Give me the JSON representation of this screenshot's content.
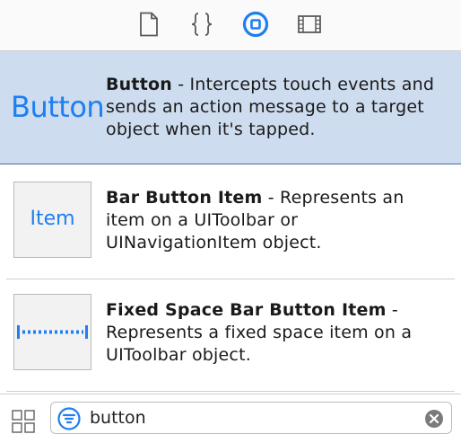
{
  "tabs": [
    {
      "icon": "file-icon",
      "selected": false
    },
    {
      "icon": "code-braces-icon",
      "selected": false
    },
    {
      "icon": "object-library-icon",
      "selected": true
    },
    {
      "icon": "media-library-icon",
      "selected": false
    }
  ],
  "items": [
    {
      "preview_text": "Button",
      "title": "Button",
      "description": " - Intercepts touch events and sends an action message to a target object when it's tapped.",
      "selected": true
    },
    {
      "preview_text": "Item",
      "title": "Bar Button Item",
      "description": " - Represents an item on a UIToolbar or UINavigationItem object.",
      "selected": false
    },
    {
      "preview_icon": "fixed-space-icon",
      "title": "Fixed Space Bar Button Item",
      "description": " - Represents a fixed space item on a UIToolbar object.",
      "selected": false
    }
  ],
  "bottom": {
    "view_toggle_icon": "grid-view-icon",
    "search": {
      "filter_icon": "filter-icon",
      "value": "button",
      "clear_icon": "clear-icon"
    }
  },
  "colors": {
    "accent": "#1d7ff0",
    "selection": "#cddcee"
  }
}
